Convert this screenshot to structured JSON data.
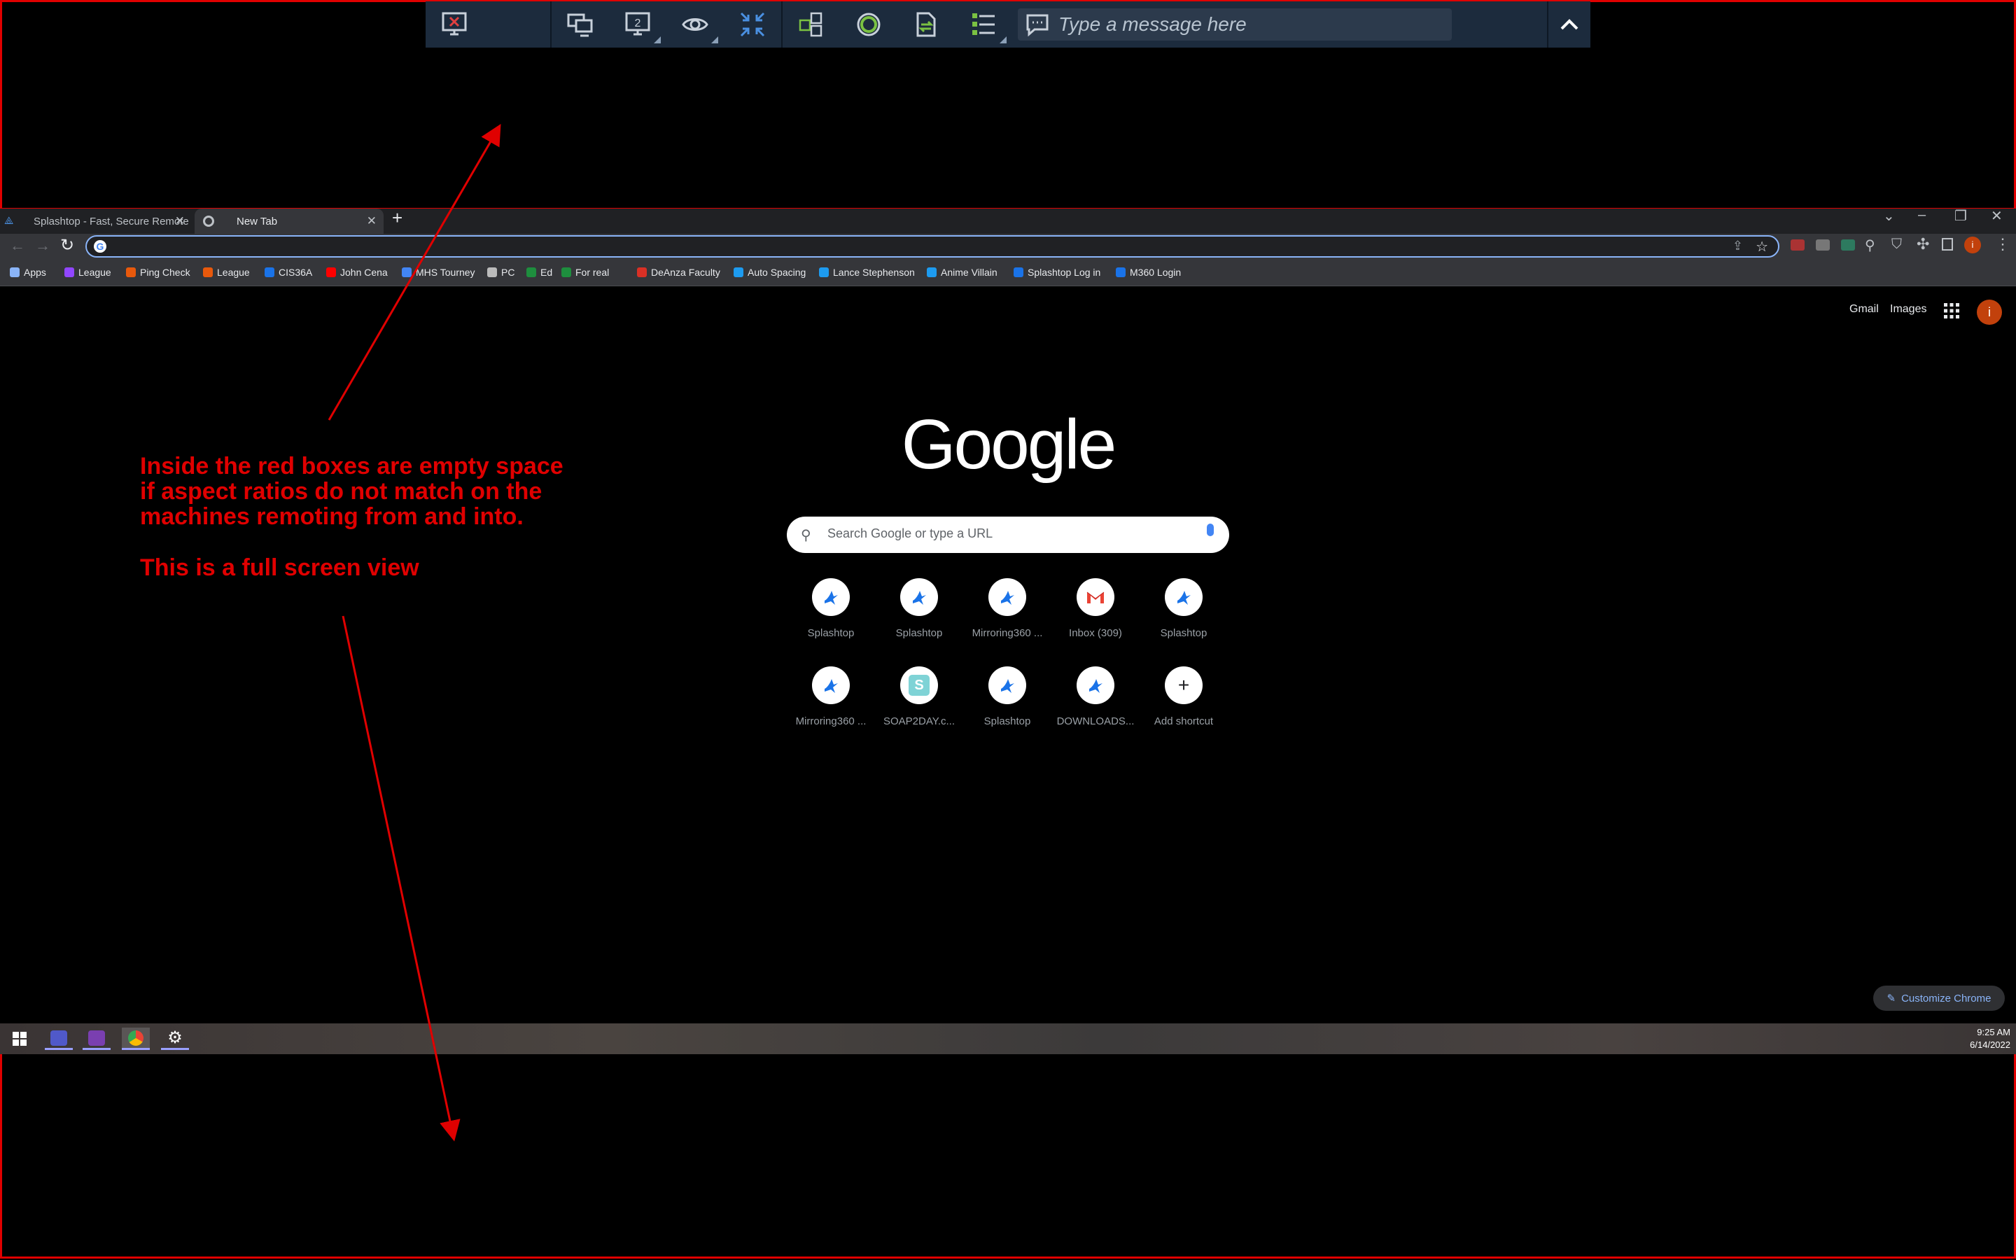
{
  "splashtop_toolbar": {
    "message_placeholder": "Type a message here"
  },
  "chrome": {
    "tabs": [
      {
        "title": "Splashtop - Fast, Secure Remote"
      },
      {
        "title": "New Tab"
      }
    ],
    "new_tab_symbol": "+",
    "bookmarks": [
      {
        "label": "Apps",
        "color": "#8ab4f8"
      },
      {
        "label": "League",
        "color": "#9146ff"
      },
      {
        "label": "Ping Check",
        "color": "#e8590c"
      },
      {
        "label": "League",
        "color": "#e8590c"
      },
      {
        "label": "CIS36A",
        "color": "#1a73e8"
      },
      {
        "label": "John Cena",
        "color": "#ff0000"
      },
      {
        "label": "MHS Tourney",
        "color": "#4285f4"
      },
      {
        "label": "PC",
        "color": "#bbbbbb"
      },
      {
        "label": "Ed",
        "color": "#1e8e3e"
      },
      {
        "label": "For real",
        "color": "#1e8e3e"
      },
      {
        "label": "DeAnza Faculty",
        "color": "#d93025"
      },
      {
        "label": "Auto Spacing",
        "color": "#1d9bf0"
      },
      {
        "label": "Lance Stephenson",
        "color": "#1d9bf0"
      },
      {
        "label": "Anime Villain",
        "color": "#1d9bf0"
      },
      {
        "label": "Splashtop Log in",
        "color": "#1a73e8"
      },
      {
        "label": "M360 Login",
        "color": "#1a73e8"
      }
    ]
  },
  "ntp": {
    "gmail": "Gmail",
    "images": "Images",
    "avatar_letter": "i",
    "logo": "Google",
    "search_placeholder": "Search Google or type a URL",
    "shortcuts": [
      {
        "label": "Splashtop",
        "icon": "splashtop-icon"
      },
      {
        "label": "Splashtop",
        "icon": "splashtop-icon"
      },
      {
        "label": "Mirroring360 ...",
        "icon": "splashtop-icon"
      },
      {
        "label": "Inbox (309)",
        "icon": "gmail-icon"
      },
      {
        "label": "Splashtop",
        "icon": "splashtop-icon"
      },
      {
        "label": "Mirroring360 ...",
        "icon": "splashtop-icon"
      },
      {
        "label": "SOAP2DAY.c...",
        "icon": "s-icon"
      },
      {
        "label": "Splashtop",
        "icon": "splashtop-icon"
      },
      {
        "label": "DOWNLOADS...",
        "icon": "splashtop-icon"
      },
      {
        "label": "Add shortcut",
        "icon": "plus-icon"
      }
    ],
    "customize": "Customize Chrome"
  },
  "taskbar": {
    "time": "9:25 AM",
    "date": "6/14/2022"
  },
  "annotation": {
    "line1": "Inside the red boxes are empty space",
    "line2": "if aspect ratios do not match on the",
    "line3": "machines remoting from and into.",
    "line4": "This is a full screen view"
  }
}
